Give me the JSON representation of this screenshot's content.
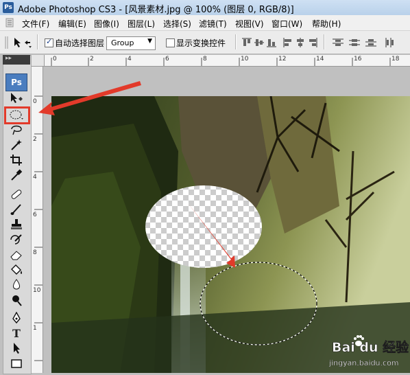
{
  "window": {
    "title": "Adobe Photoshop CS3 - [风景素材.jpg @ 100% (图层 0, RGB/8)]",
    "app_logo": "Ps"
  },
  "menu": {
    "items": [
      "文件(F)",
      "编辑(E)",
      "图像(I)",
      "图层(L)",
      "选择(S)",
      "滤镜(T)",
      "视图(V)",
      "窗口(W)",
      "帮助(H)"
    ]
  },
  "options": {
    "auto_select_label": "自动选择图层",
    "auto_select_checked": true,
    "group_value": "Group",
    "show_transform_label": "显示变换控件",
    "show_transform_checked": false
  },
  "toolbox": {
    "logo": "Ps",
    "grip": "▸▸",
    "tools": [
      "move-tool",
      "elliptical-marquee-tool",
      "lasso-tool",
      "magic-wand-tool",
      "crop-tool",
      "eyedropper-tool",
      "healing-brush-tool",
      "brush-tool",
      "clone-stamp-tool",
      "history-brush-tool",
      "eraser-tool",
      "paint-bucket-tool",
      "blur-tool",
      "dodge-tool",
      "pen-tool",
      "type-tool",
      "path-selection-tool",
      "rectangle-tool"
    ],
    "highlighted_tool": "elliptical-marquee-tool",
    "highlight_color": "#e23a2a"
  },
  "rulers": {
    "top_labels": [
      "0",
      "2",
      "4",
      "6",
      "8",
      "10",
      "12",
      "14",
      "16",
      "18"
    ],
    "left_labels": [
      "0",
      "2",
      "4",
      "6",
      "8",
      "10",
      "1"
    ]
  },
  "watermark": {
    "brand": "Bai du 经验",
    "url": "jingyan.baidu.com"
  },
  "colors": {
    "annotation_red": "#e23a2a",
    "transparency_check": "#cccccc"
  }
}
